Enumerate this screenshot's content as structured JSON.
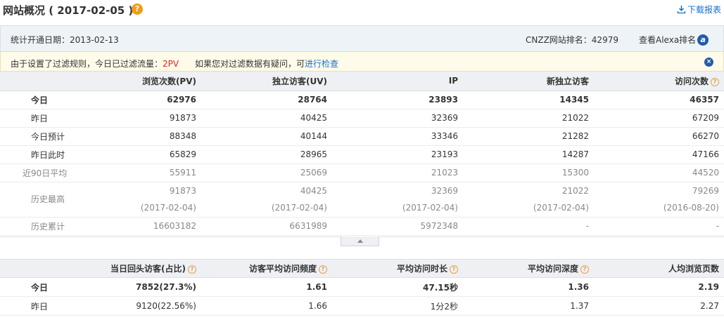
{
  "title": {
    "text": "网站概况 ( 2017-02-05 )",
    "help": "?"
  },
  "download": {
    "label": "下载报表"
  },
  "stats": {
    "since": "统计开通日期：2013-02-13",
    "rank": "CNZZ网站排名：42979",
    "alexa": "查看Alexa排名",
    "alexa_icon": "a"
  },
  "notice": {
    "pre": "由于设置了过滤规则，今日已过滤流量：",
    "value": "2PV",
    "mid": "      如果您对过滤数据有疑问，可",
    "link": "进行检查",
    "close": "×"
  },
  "table1": {
    "headers": [
      "",
      "浏览次数(PV)",
      "独立访客(UV)",
      "IP",
      "新独立访客",
      "访问次数"
    ],
    "rows": [
      {
        "label": "今日",
        "values": [
          "62976",
          "28764",
          "23893",
          "14345",
          "46357"
        ]
      },
      {
        "label": "昨日",
        "values": [
          "91873",
          "40425",
          "32369",
          "21022",
          "67209"
        ]
      },
      {
        "label": "今日预计",
        "values": [
          "88348",
          "40144",
          "33346",
          "21282",
          "66270"
        ]
      },
      {
        "label": "昨日此时",
        "values": [
          "65829",
          "28965",
          "23193",
          "14287",
          "47166"
        ]
      },
      {
        "label": "近90日平均",
        "values": [
          "55911",
          "25069",
          "21023",
          "15300",
          "44520"
        ]
      },
      {
        "label": "历史最高",
        "values": [
          "91873",
          "40425",
          "32369",
          "21022",
          "79269"
        ],
        "dates": [
          "(2017-02-04)",
          "(2017-02-04)",
          "(2017-02-04)",
          "(2017-02-04)",
          "(2016-08-20)"
        ]
      },
      {
        "label": "历史累计",
        "values": [
          "16603182",
          "6631989",
          "5972348",
          "-",
          "-"
        ]
      }
    ]
  },
  "table2": {
    "headers": [
      "",
      "当日回头访客(占比)",
      "访客平均访问频度",
      "平均访问时长",
      "平均访问深度",
      "人均浏览页数"
    ],
    "rows": [
      {
        "label": "今日",
        "values": [
          "7852(27.3%)",
          "1.61",
          "47.15秒",
          "1.36",
          "2.19"
        ]
      },
      {
        "label": "昨日",
        "values": [
          "9120(22.56%)",
          "1.66",
          "1分2秒",
          "1.37",
          "2.27"
        ]
      }
    ]
  },
  "colors": {
    "accent": "#1a6fc9",
    "warn": "#e0261c",
    "help": "#f39c12",
    "header_bg": "#eef0f3"
  },
  "icons": {
    "help": "question-circle-icon",
    "download": "download-icon",
    "alexa": "alexa-icon",
    "close": "close-icon",
    "collapse": "chevron-up-icon"
  }
}
